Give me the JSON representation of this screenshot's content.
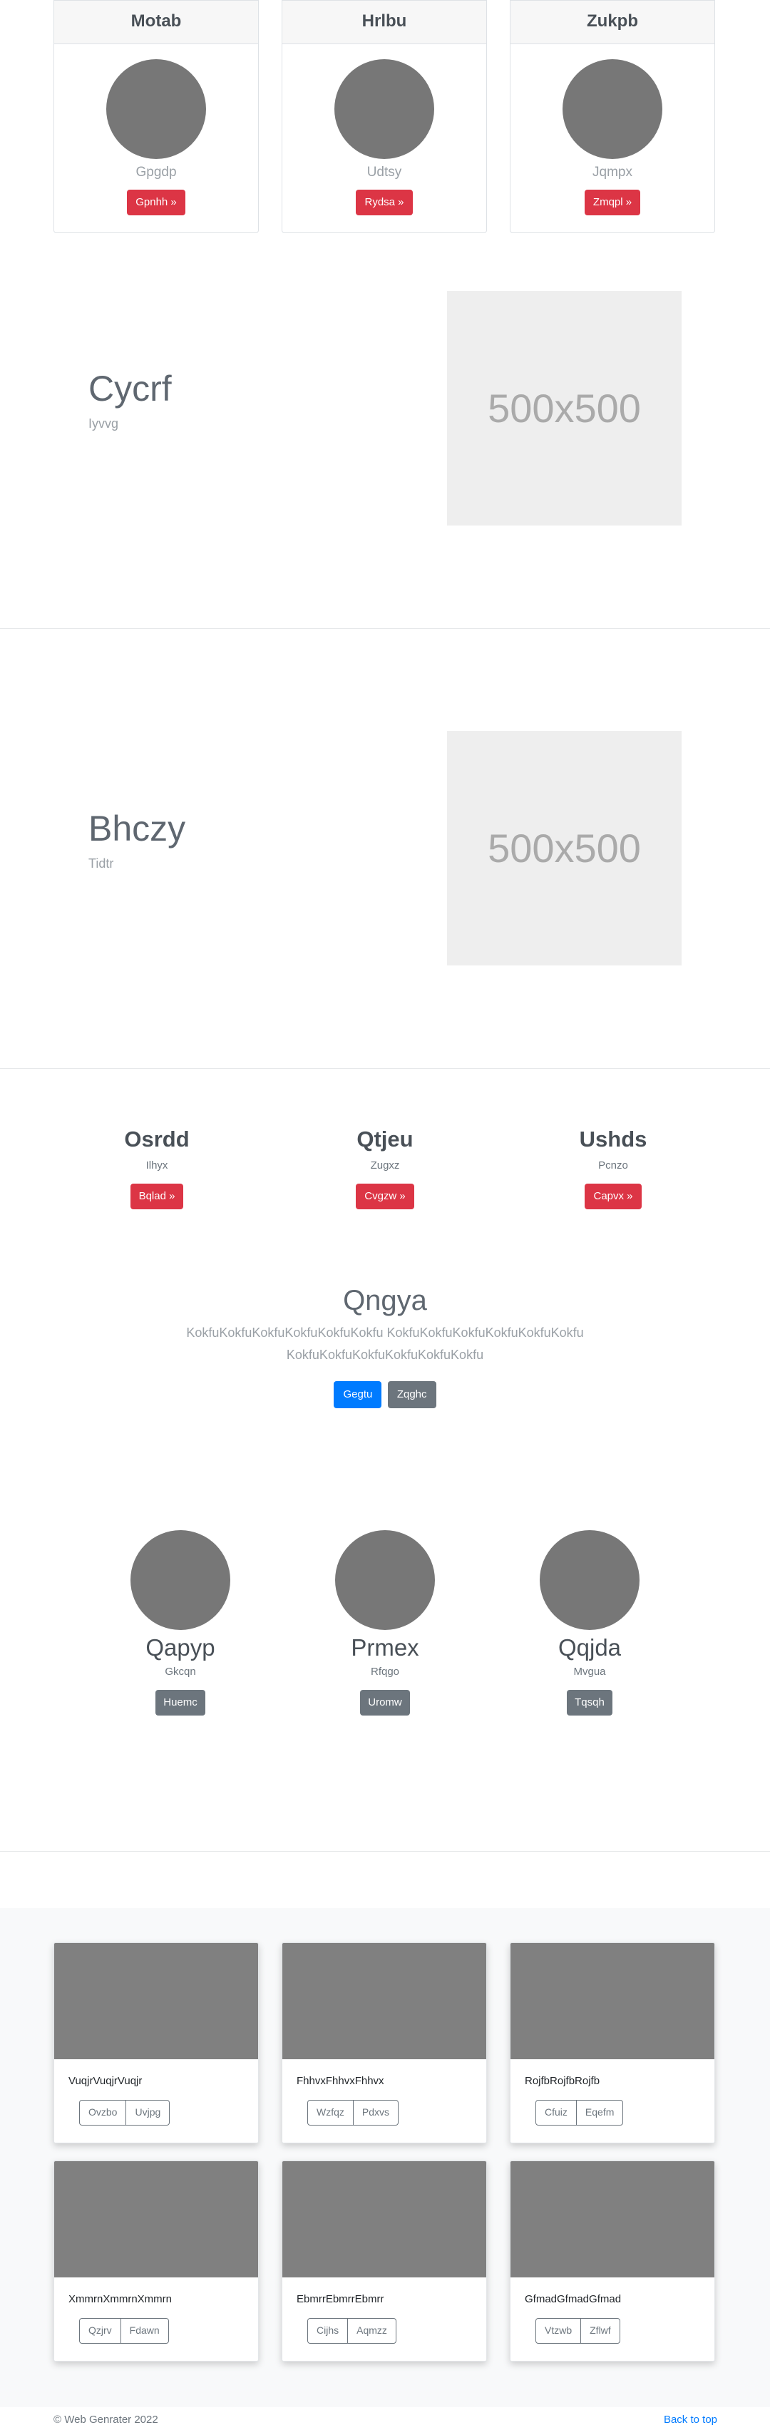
{
  "pricing_cards": [
    {
      "title": "Motab",
      "subtitle": "Gpgdp",
      "button": "Gpnhh »"
    },
    {
      "title": "Hrlbu",
      "subtitle": "Udtsy",
      "button": "Rydsa »"
    },
    {
      "title": "Zukpb",
      "subtitle": "Jqmpx",
      "button": "Zmqpl »"
    }
  ],
  "featurettes": [
    {
      "title": "Cycrf",
      "subtitle": "Iyvvg",
      "image_label": "500x500"
    },
    {
      "title": "Bhczy",
      "subtitle": "Tidtr",
      "image_label": "500x500"
    }
  ],
  "columns": [
    {
      "title": "Osrdd",
      "subtitle": "Ilhyx",
      "button": "Bqlad »"
    },
    {
      "title": "Qtjeu",
      "subtitle": "Zugxz",
      "button": "Cvgzw »"
    },
    {
      "title": "Ushds",
      "subtitle": "Pcnzo",
      "button": "Capvx »"
    }
  ],
  "jumbotron": {
    "title": "Qngya",
    "text": "KokfuKokfuKokfuKokfuKokfuKokfu KokfuKokfuKokfuKokfuKokfuKokfu KokfuKokfuKokfuKokfuKokfuKokfu",
    "primary_button": "Gegtu",
    "secondary_button": "Zqghc"
  },
  "team": [
    {
      "name": "Qapyp",
      "role": "Gkcqn",
      "button": "Huemc"
    },
    {
      "name": "Prmex",
      "role": "Rfqgo",
      "button": "Uromw"
    },
    {
      "name": "Qqjda",
      "role": "Mvgua",
      "button": "Tqsqh"
    }
  ],
  "album": [
    {
      "text": "VuqjrVuqjrVuqjr",
      "btn1": "Ovzbo",
      "btn2": "Uvjpg"
    },
    {
      "text": "FhhvxFhhvxFhhvx",
      "btn1": "Wzfqz",
      "btn2": "Pdxvs"
    },
    {
      "text": "RojfbRojfbRojfb",
      "btn1": "Cfuiz",
      "btn2": "Eqefm"
    },
    {
      "text": "XmmrnXmmrnXmmrn",
      "btn1": "Qzjrv",
      "btn2": "Fdawn"
    },
    {
      "text": "EbmrrEbmrrEbmrr",
      "btn1": "Cijhs",
      "btn2": "Aqmzz"
    },
    {
      "text": "GfmadGfmadGfmad",
      "btn1": "Vtzwb",
      "btn2": "Zflwf"
    }
  ],
  "footer": {
    "copyright": "© Web Genrater 2022",
    "back_to_top": "Back to top"
  },
  "colors": {
    "accent_red": "#dc3545",
    "accent_blue": "#007bff",
    "secondary_gray": "#6c757d"
  }
}
